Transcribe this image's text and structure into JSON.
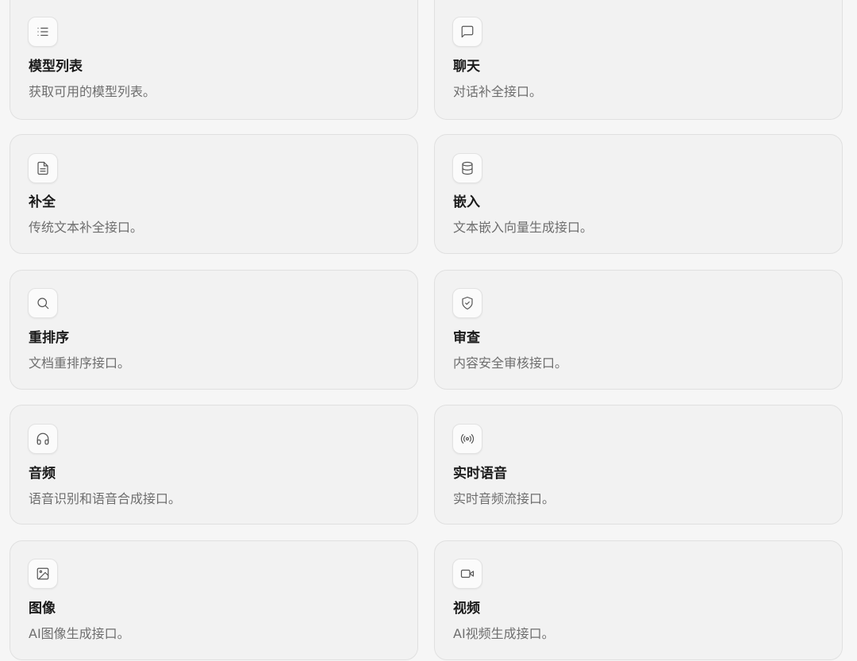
{
  "cards": [
    {
      "title": "模型列表",
      "desc": "获取可用的模型列表。",
      "icon": "list-icon"
    },
    {
      "title": "聊天",
      "desc": "对话补全接口。",
      "icon": "chat-bubble-icon"
    },
    {
      "title": "补全",
      "desc": "传统文本补全接口。",
      "icon": "document-icon"
    },
    {
      "title": "嵌入",
      "desc": "文本嵌入向量生成接口。",
      "icon": "database-icon"
    },
    {
      "title": "重排序",
      "desc": "文档重排序接口。",
      "icon": "search-icon"
    },
    {
      "title": "审查",
      "desc": "内容安全审核接口。",
      "icon": "shield-check-icon"
    },
    {
      "title": "音频",
      "desc": "语音识别和语音合成接口。",
      "icon": "headphones-icon"
    },
    {
      "title": "实时语音",
      "desc": "实时音频流接口。",
      "icon": "broadcast-icon"
    },
    {
      "title": "图像",
      "desc": "AI图像生成接口。",
      "icon": "image-icon"
    },
    {
      "title": "视频",
      "desc": "AI视频生成接口。",
      "icon": "video-camera-icon"
    }
  ]
}
